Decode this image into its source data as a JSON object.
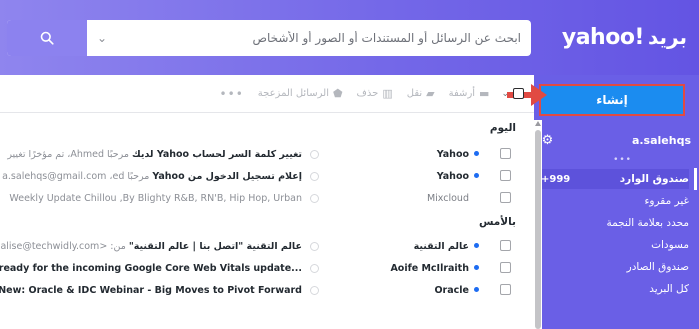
{
  "header": {
    "logo_mail": "بريد",
    "logo_yahoo": "yahoo!",
    "search_placeholder": "ابحث عن الرسائل أو المستندات أو الصور أو الأشخاص"
  },
  "sidebar": {
    "compose_label": "إنشاء",
    "account_name": "a.salehqs",
    "dots": "•••",
    "items": [
      {
        "label": "صندوق الوارد",
        "badge": "999+"
      },
      {
        "label": "غير مقروء"
      },
      {
        "label": "محدد بعلامة النجمة"
      },
      {
        "label": "مسودات"
      },
      {
        "label": "صندوق الصادر"
      },
      {
        "label": "كل البريد"
      }
    ]
  },
  "toolbar": {
    "archive": "أرشفة",
    "move": "نقل",
    "delete": "حذف",
    "spam": "الرسائل المزعجة",
    "more": "•••"
  },
  "groups": {
    "today": "اليوم",
    "yesterday": "بالأمس"
  },
  "messages": [
    {
      "sender": "Yahoo",
      "unread": true,
      "subject": "تغيير كلمة السر لحساب Yahoo لديك",
      "snippet": " مرحبًا Ahmed، تم مؤخرًا تغيير"
    },
    {
      "sender": "Yahoo",
      "unread": true,
      "subject": "إعلام تسجيل الدخول من Yahoo",
      "snippet": " مرحبًا a.salehqs@gmail.com ،ed"
    },
    {
      "sender": "Mixcloud",
      "unread": false,
      "subject": "",
      "snippet": "Weekly Update   Chillou ,By Blighty R&B, RN'B, Hip Hop, Urban"
    },
    {
      "sender": "عالم التقنية",
      "unread": true,
      "subject": "عالم التقنية \"اتصل بنا | عالم التقنية\"",
      "snippet": " من: <alise@techwidly.com"
    },
    {
      "sender": "Aoife McIlraith",
      "unread": true,
      "subject": "...site ready for the incoming Google Core Web Vitals update",
      "snippet": ""
    },
    {
      "sender": "Oracle",
      "unread": true,
      "subject": "New: Oracle & IDC Webinar - Big Moves to Pivot Forward",
      "snippet": ""
    }
  ],
  "colors": {
    "header_start": "#8f85ee",
    "header_end": "#6354e3",
    "sidebar": "#6a5fe6",
    "compose": "#1b8cf0",
    "highlight": "#e14a43",
    "unread_dot": "#1d6cf2"
  }
}
